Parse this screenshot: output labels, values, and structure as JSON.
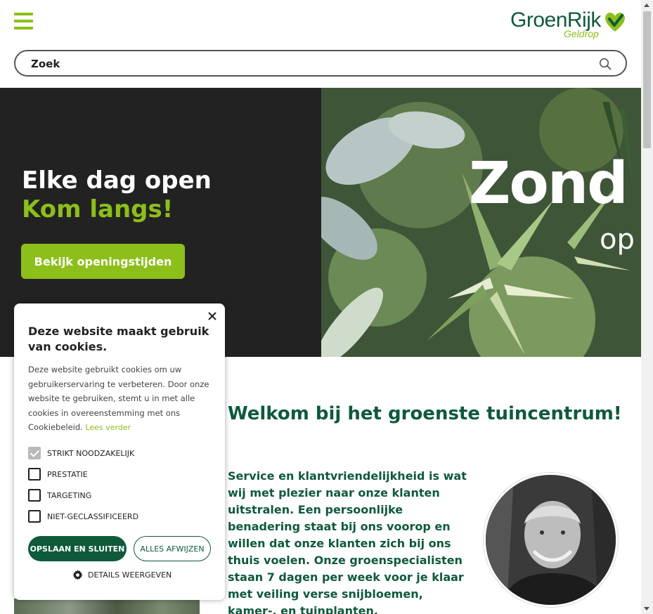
{
  "header": {
    "menu_icon": "hamburger-menu-icon",
    "logo": {
      "main": "GroenRijk",
      "sub": "Geldrop",
      "brand_green": "#8cbf1a",
      "brand_dark": "#0e5a3a"
    }
  },
  "search": {
    "placeholder": "Zoek",
    "icon": "search-icon"
  },
  "hero": {
    "title": "Elke dag open",
    "subtitle": "Kom langs!",
    "button_label": "Bekijk openingstijden",
    "image_overlay_line1": "Zond",
    "image_overlay_line2": "op"
  },
  "main": {
    "welcome": "Welkom bij het groenste tuincentrum!",
    "intro": "Service en klantvriendelijkheid is wat wij met plezier naar onze klanten uitstralen. Een persoonlijke benadering staat bij ons voorop en willen dat onze klanten zich bij ons thuis voelen. Onze groenspecialisten staan 7 dagen per week voor je klaar met veiling verse snijbloemen, kamer-, en tuinplanten."
  },
  "cookie": {
    "title": "Deze website maakt gebruik van cookies.",
    "text": "Deze website gebruikt cookies om uw gebruikerservaring te verbeteren. Door onze website te gebruiken, stemt u in met alle cookies in overeenstemming met ons Cookiebeleid.",
    "link": "Lees verder",
    "options": [
      {
        "label": "STRIKT NOODZAKELIJK",
        "checked": true
      },
      {
        "label": "PRESTATIE",
        "checked": false
      },
      {
        "label": "TARGETING",
        "checked": false
      },
      {
        "label": "NIET-GECLASSIFICEERD",
        "checked": false
      }
    ],
    "save_button": "OPSLAAN EN SLUITEN",
    "reject_button": "ALLES AFWIJZEN",
    "details_label": "DETAILS WEERGEVEN",
    "details_icon": "gear-icon",
    "close_icon": "close-icon"
  }
}
